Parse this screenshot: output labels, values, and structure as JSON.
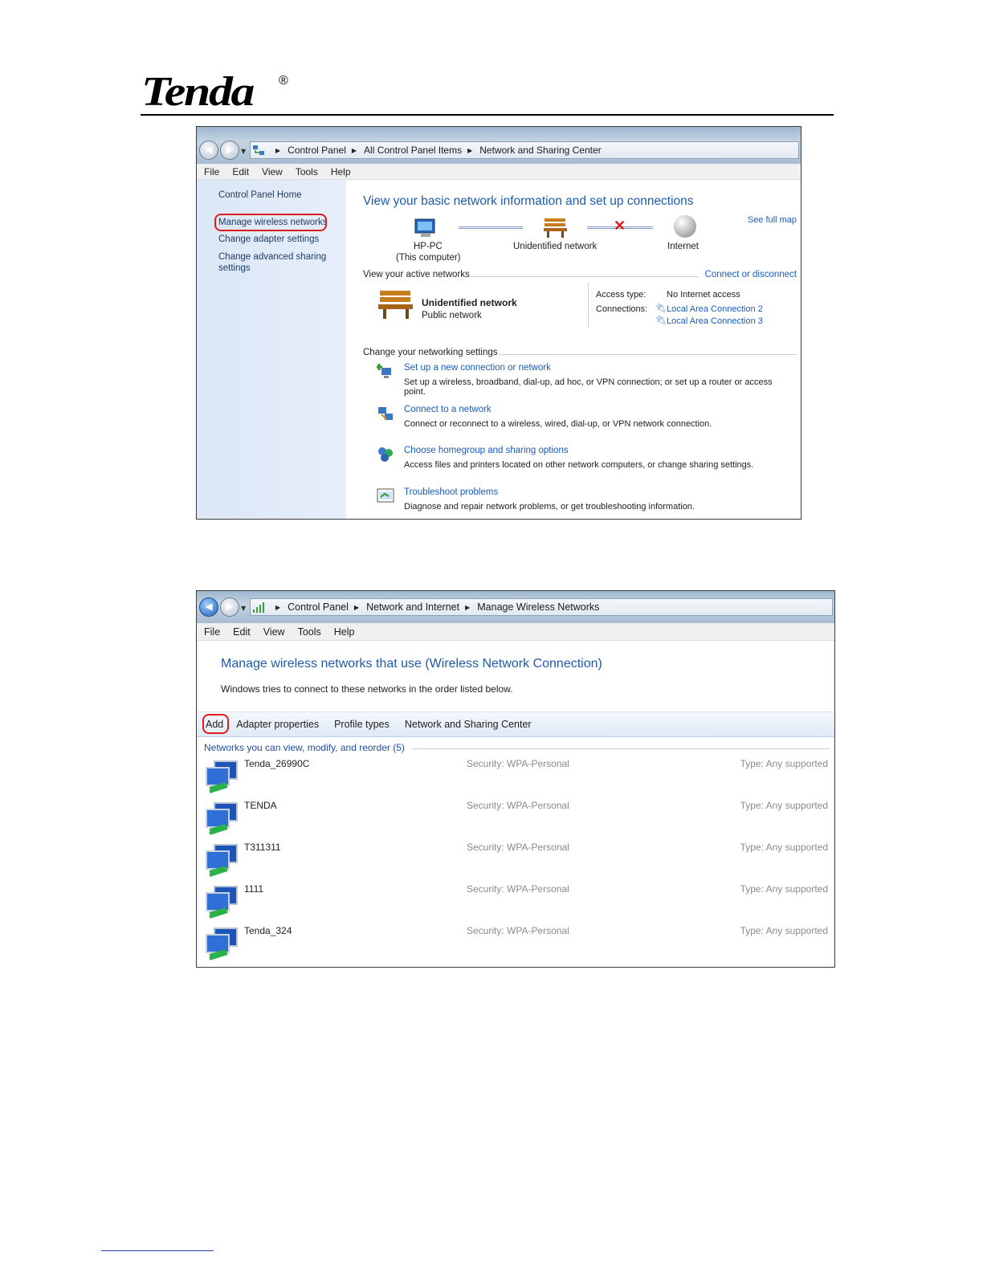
{
  "brand": {
    "logo_text": "Tenda",
    "registered_mark": "®"
  },
  "window1": {
    "breadcrumb": [
      "Control Panel",
      "All Control Panel Items",
      "Network and Sharing Center"
    ],
    "menu": [
      "File",
      "Edit",
      "View",
      "Tools",
      "Help"
    ],
    "sidebar": {
      "home": "Control Panel Home",
      "items": [
        "Manage wireless networks",
        "Change adapter settings",
        "Change advanced sharing",
        "settings"
      ]
    },
    "main": {
      "title": "View your basic network information and set up connections",
      "see_full_map": "See full map",
      "map": {
        "computer_name": "HP-PC",
        "computer_sub": "(This computer)",
        "network": "Unidentified network",
        "internet": "Internet"
      },
      "active_heading": "View your active networks",
      "connect_disconnect": "Connect or disconnect",
      "active_network": {
        "name": "Unidentified network",
        "category": "Public network",
        "access_type_label": "Access type:",
        "access_type_value": "No Internet access",
        "connections_label": "Connections:",
        "connections": [
          "Local Area Connection 2",
          "Local Area Connection 3"
        ]
      },
      "settings_heading": "Change your networking settings",
      "tasks": [
        {
          "title": "Set up a new connection or network",
          "desc": "Set up a wireless, broadband, dial-up, ad hoc, or VPN connection; or set up a router or access point."
        },
        {
          "title": "Connect to a network",
          "desc": "Connect or reconnect to a wireless, wired, dial-up, or VPN network connection."
        },
        {
          "title": "Choose homegroup and sharing options",
          "desc": "Access files and printers located on other network computers, or change sharing settings."
        },
        {
          "title": "Troubleshoot problems",
          "desc": "Diagnose and repair network problems, or get troubleshooting information."
        }
      ]
    }
  },
  "window2": {
    "breadcrumb": [
      "Control Panel",
      "Network and Internet",
      "Manage Wireless Networks"
    ],
    "menu": [
      "File",
      "Edit",
      "View",
      "Tools",
      "Help"
    ],
    "title": "Manage wireless networks that use (Wireless Network Connection)",
    "subtitle": "Windows tries to connect to these networks in the order listed below.",
    "toolbar": [
      "Add",
      "Adapter properties",
      "Profile types",
      "Network and Sharing Center"
    ],
    "list_heading": "Networks you can view, modify, and reorder (5)",
    "networks": [
      {
        "name": "Tenda_26990C",
        "security_label": "Security:",
        "security": "WPA-Personal",
        "type_label": "Type:",
        "type": "Any supported"
      },
      {
        "name": "TENDA",
        "security_label": "Security:",
        "security": "WPA-Personal",
        "type_label": "Type:",
        "type": "Any supported"
      },
      {
        "name": "T311311",
        "security_label": "Security:",
        "security": "WPA-Personal",
        "type_label": "Type:",
        "type": "Any supported"
      },
      {
        "name": "1111",
        "security_label": "Security:",
        "security": "WPA-Personal",
        "type_label": "Type:",
        "type": "Any supported"
      },
      {
        "name": "Tenda_324",
        "security_label": "Security:",
        "security": "WPA-Personal",
        "type_label": "Type:",
        "type": "Any supported"
      }
    ]
  },
  "colors": {
    "link_blue": "#1a5cb8",
    "highlight_red": "#e01b1b",
    "sidebar_bg": "#dbe7f6"
  }
}
